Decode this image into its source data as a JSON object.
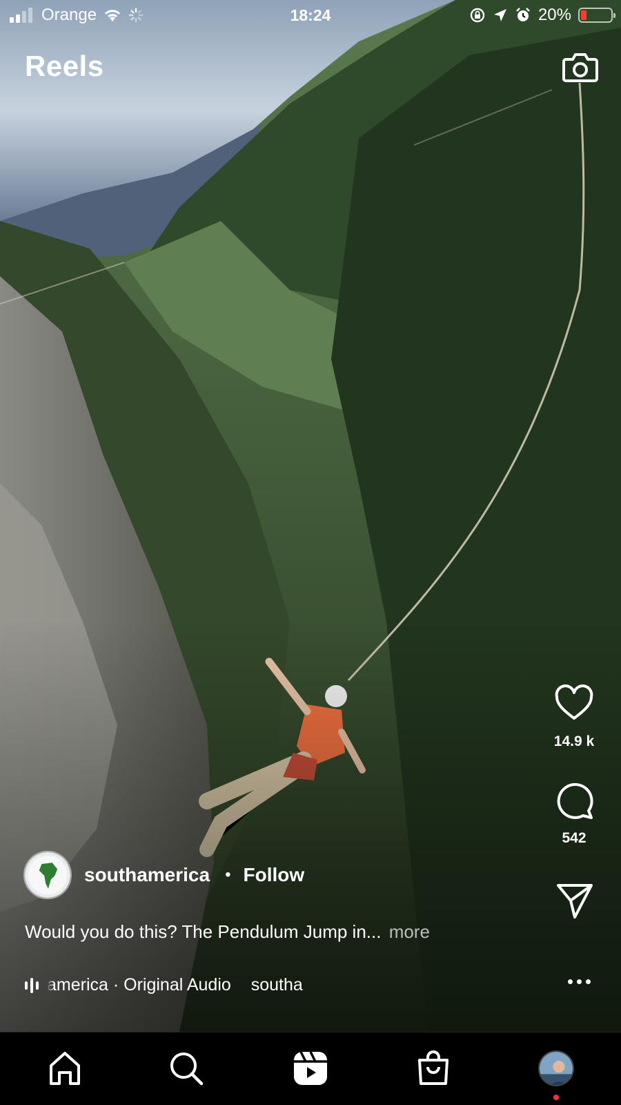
{
  "status_bar": {
    "carrier": "Orange",
    "time": "18:24",
    "battery_percent": "20%",
    "battery_level": 0.2,
    "battery_color": "#ff3b30"
  },
  "header": {
    "title": "Reels",
    "camera_icon": "camera-icon"
  },
  "reel": {
    "author": "southamerica",
    "separator": "•",
    "follow_label": "Follow",
    "caption": "Would you do this? The Pendulum Jump in...",
    "caption_more": "more",
    "audio": "america · Original Audio",
    "audio_scroll": "southa",
    "likes": "14.9 k",
    "comments": "542"
  },
  "icons": {
    "like": "heart-icon",
    "comment": "comment-bubble-icon",
    "share": "paper-plane-icon",
    "more": "more-horizontal-icon",
    "audio": "audio-waveform-icon"
  },
  "bottom_nav": {
    "items": [
      "home-icon",
      "search-icon",
      "reels-icon",
      "shop-icon",
      "profile-avatar"
    ],
    "active": "reels-icon",
    "notification_color": "#ff3040"
  }
}
